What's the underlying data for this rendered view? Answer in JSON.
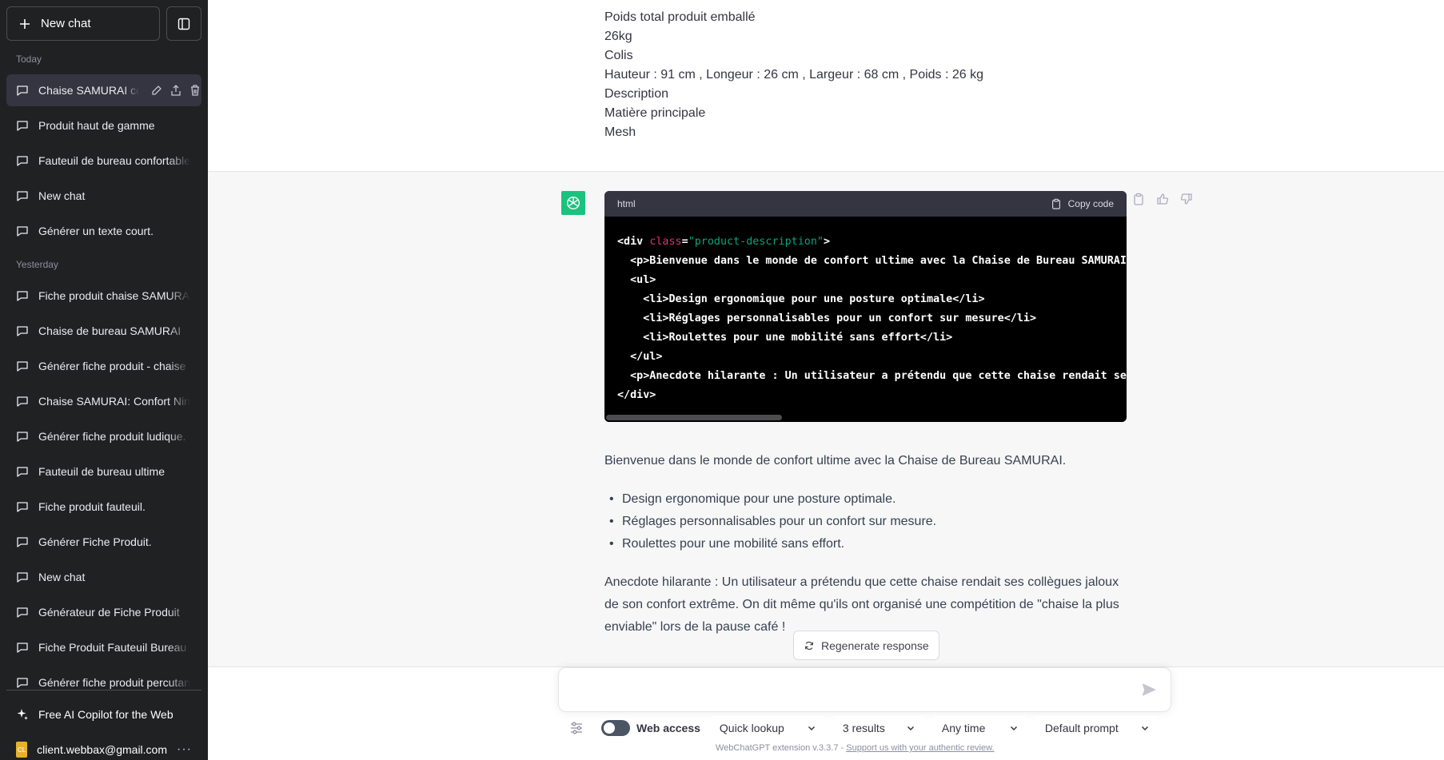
{
  "sidebar": {
    "new_chat_label": "New chat",
    "sections": [
      {
        "label": "Today",
        "items": [
          "Chaise SAMURAI co",
          "Produit haut de gamme",
          "Fauteuil de bureau confortable",
          "New chat",
          "Générer un texte court."
        ]
      },
      {
        "label": "Yesterday",
        "items": [
          "Fiche produit chaise SAMURAI",
          "Chaise de bureau SAMURAI",
          "Générer fiche produit - chaise",
          "Chaise SAMURAI: Confort Ninja",
          "Générer fiche produit ludique.",
          "Fauteuil de bureau ultime",
          "Fiche produit fauteuil.",
          "Générer Fiche Produit.",
          "New chat",
          "Générateur de Fiche Produit",
          "Fiche Produit Fauteuil Bureau",
          "Générer fiche produit percutant"
        ]
      }
    ],
    "copilot_label": "Free AI Copilot for the Web",
    "user_email": "client.webbax@gmail.com",
    "user_initials": "CL"
  },
  "user_message": {
    "lines": [
      "Poids total produit emballé",
      "26kg",
      "Colis",
      "Hauteur : 91 cm , Longeur : 26 cm , Largeur : 68 cm , Poids : 26 kg",
      "Description",
      "Matière principale",
      "Mesh"
    ]
  },
  "code_block": {
    "language": "html",
    "copy_label": "Copy code",
    "line1_tag": "<div ",
    "line1_attr": "class",
    "line1_eq": "=",
    "line1_str": "\"product-description\"",
    "line1_end": ">",
    "line2": "  <p>Bienvenue dans le monde de confort ultime avec la Chaise de Bureau SAMURAI.</p>",
    "line3": "  <ul>",
    "line4": "    <li>Design ergonomique pour une posture optimale</li>",
    "line5": "    <li>Réglages personnalisables pour un confort sur mesure</li>",
    "line6": "    <li>Roulettes pour une mobilité sans effort</li>",
    "line7": "  </ul>",
    "line8": "  <p>Anecdote hilarante : Un utilisateur a prétendu que cette chaise rendait ses collègues jaloux</p>",
    "line9": "</div>"
  },
  "assistant": {
    "intro": "Bienvenue dans le monde de confort ultime avec la Chaise de Bureau SAMURAI.",
    "bullets": [
      "Design ergonomique pour une posture optimale.",
      "Réglages personnalisables pour un confort sur mesure.",
      "Roulettes pour une mobilité sans effort."
    ],
    "anecdote": "Anecdote hilarante : Un utilisateur a prétendu que cette chaise rendait ses collègues jaloux de son confort extrême. On dit même qu'ils ont organisé une compétition de \"chaise la plus enviable\" lors de la pause café !"
  },
  "regenerate_label": "Regenerate response",
  "input": {
    "placeholder": ""
  },
  "toolbar": {
    "web_access_label": "Web access",
    "mode": "Quick lookup",
    "results": "3 results",
    "time": "Any time",
    "prompt": "Default prompt"
  },
  "footer": {
    "version_text": "WebChatGPT extension v.3.3.7 - ",
    "support_link": "Support us with your authentic review."
  },
  "colors": {
    "sidebar_bg": "#202123",
    "accent": "#19c37d",
    "code_bg": "#000000"
  }
}
